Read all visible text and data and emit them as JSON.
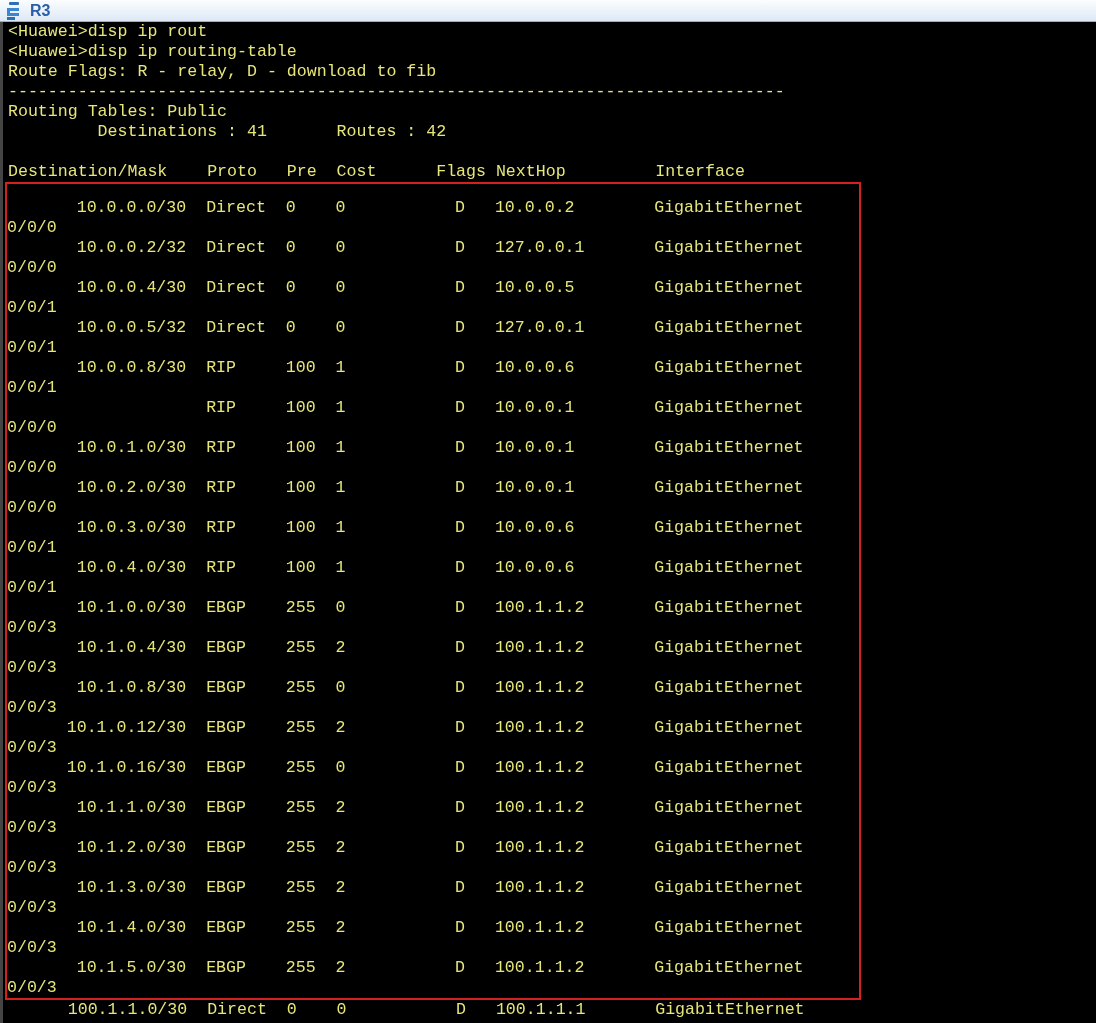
{
  "window": {
    "title": "R3"
  },
  "terminal": {
    "intro_lines": [
      "<Huawei>disp ip rout",
      "<Huawei>disp ip routing-table",
      "Route Flags: R - relay, D - download to fib",
      "------------------------------------------------------------------------------",
      "Routing Tables: Public"
    ],
    "summary": {
      "destinations_label": "Destinations : 41",
      "routes_label": "Routes : 42"
    },
    "columns": [
      "Destination/Mask",
      "Proto",
      "Pre",
      "Cost",
      "Flags",
      "NextHop",
      "Interface"
    ],
    "highlighted_rows": [
      {
        "destination": "10.0.0.0/30",
        "proto": "Direct",
        "pre": "0",
        "cost": "0",
        "flags": "D",
        "nexthop": "10.0.0.2",
        "interface": "GigabitEthernet",
        "interface_cont": "0/0/0"
      },
      {
        "destination": "10.0.0.2/32",
        "proto": "Direct",
        "pre": "0",
        "cost": "0",
        "flags": "D",
        "nexthop": "127.0.0.1",
        "interface": "GigabitEthernet",
        "interface_cont": "0/0/0"
      },
      {
        "destination": "10.0.0.4/30",
        "proto": "Direct",
        "pre": "0",
        "cost": "0",
        "flags": "D",
        "nexthop": "10.0.0.5",
        "interface": "GigabitEthernet",
        "interface_cont": "0/0/1"
      },
      {
        "destination": "10.0.0.5/32",
        "proto": "Direct",
        "pre": "0",
        "cost": "0",
        "flags": "D",
        "nexthop": "127.0.0.1",
        "interface": "GigabitEthernet",
        "interface_cont": "0/0/1"
      },
      {
        "destination": "10.0.0.8/30",
        "proto": "RIP",
        "pre": "100",
        "cost": "1",
        "flags": "D",
        "nexthop": "10.0.0.6",
        "interface": "GigabitEthernet",
        "interface_cont": "0/0/1"
      },
      {
        "proto": "RIP",
        "pre": "100",
        "cost": "1",
        "flags": "D",
        "nexthop": "10.0.0.1",
        "interface": "GigabitEthernet",
        "interface_cont": "0/0/0"
      },
      {
        "destination": "10.0.1.0/30",
        "proto": "RIP",
        "pre": "100",
        "cost": "1",
        "flags": "D",
        "nexthop": "10.0.0.1",
        "interface": "GigabitEthernet",
        "interface_cont": "0/0/0"
      },
      {
        "destination": "10.0.2.0/30",
        "proto": "RIP",
        "pre": "100",
        "cost": "1",
        "flags": "D",
        "nexthop": "10.0.0.1",
        "interface": "GigabitEthernet",
        "interface_cont": "0/0/0"
      },
      {
        "destination": "10.0.3.0/30",
        "proto": "RIP",
        "pre": "100",
        "cost": "1",
        "flags": "D",
        "nexthop": "10.0.0.6",
        "interface": "GigabitEthernet",
        "interface_cont": "0/0/1"
      },
      {
        "destination": "10.0.4.0/30",
        "proto": "RIP",
        "pre": "100",
        "cost": "1",
        "flags": "D",
        "nexthop": "10.0.0.6",
        "interface": "GigabitEthernet",
        "interface_cont": "0/0/1"
      },
      {
        "destination": "10.1.0.0/30",
        "proto": "EBGP",
        "pre": "255",
        "cost": "0",
        "flags": "D",
        "nexthop": "100.1.1.2",
        "interface": "GigabitEthernet",
        "interface_cont": "0/0/3"
      },
      {
        "destination": "10.1.0.4/30",
        "proto": "EBGP",
        "pre": "255",
        "cost": "2",
        "flags": "D",
        "nexthop": "100.1.1.2",
        "interface": "GigabitEthernet",
        "interface_cont": "0/0/3"
      },
      {
        "destination": "10.1.0.8/30",
        "proto": "EBGP",
        "pre": "255",
        "cost": "0",
        "flags": "D",
        "nexthop": "100.1.1.2",
        "interface": "GigabitEthernet",
        "interface_cont": "0/0/3"
      },
      {
        "destination": "10.1.0.12/30",
        "proto": "EBGP",
        "pre": "255",
        "cost": "2",
        "flags": "D",
        "nexthop": "100.1.1.2",
        "interface": "GigabitEthernet",
        "interface_cont": "0/0/3"
      },
      {
        "destination": "10.1.0.16/30",
        "proto": "EBGP",
        "pre": "255",
        "cost": "0",
        "flags": "D",
        "nexthop": "100.1.1.2",
        "interface": "GigabitEthernet",
        "interface_cont": "0/0/3"
      },
      {
        "destination": "10.1.1.0/30",
        "proto": "EBGP",
        "pre": "255",
        "cost": "2",
        "flags": "D",
        "nexthop": "100.1.1.2",
        "interface": "GigabitEthernet",
        "interface_cont": "0/0/3"
      },
      {
        "destination": "10.1.2.0/30",
        "proto": "EBGP",
        "pre": "255",
        "cost": "2",
        "flags": "D",
        "nexthop": "100.1.1.2",
        "interface": "GigabitEthernet",
        "interface_cont": "0/0/3"
      },
      {
        "destination": "10.1.3.0/30",
        "proto": "EBGP",
        "pre": "255",
        "cost": "2",
        "flags": "D",
        "nexthop": "100.1.1.2",
        "interface": "GigabitEthernet",
        "interface_cont": "0/0/3"
      },
      {
        "destination": "10.1.4.0/30",
        "proto": "EBGP",
        "pre": "255",
        "cost": "2",
        "flags": "D",
        "nexthop": "100.1.1.2",
        "interface": "GigabitEthernet",
        "interface_cont": "0/0/3"
      },
      {
        "destination": "10.1.5.0/30",
        "proto": "EBGP",
        "pre": "255",
        "cost": "2",
        "flags": "D",
        "nexthop": "100.1.1.2",
        "interface": "GigabitEthernet",
        "interface_cont": "0/0/3"
      }
    ],
    "rows_after": [
      {
        "destination": "100.1.1.0/30",
        "proto": "Direct",
        "pre": "0",
        "cost": "0",
        "flags": "D",
        "nexthop": "100.1.1.1",
        "interface": "GigabitEthernet"
      }
    ]
  }
}
